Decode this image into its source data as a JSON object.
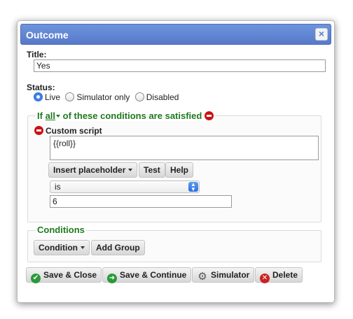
{
  "dialog": {
    "title": "Outcome",
    "close_icon": "close-icon"
  },
  "title_field": {
    "label": "Title:",
    "value": "Yes"
  },
  "status": {
    "label": "Status:",
    "options": [
      {
        "label": "Live",
        "checked": true
      },
      {
        "label": "Simulator only",
        "checked": false
      },
      {
        "label": "Disabled",
        "checked": false
      }
    ]
  },
  "condition_group": {
    "prefix": "If",
    "mode": "all",
    "suffix": "of these conditions are satisfied",
    "condition": {
      "label": "Custom script",
      "script": "{{roll}}",
      "insert_placeholder_label": "Insert placeholder",
      "test_label": "Test",
      "help_label": "Help",
      "operator": "is",
      "value": "6"
    }
  },
  "conditions_section": {
    "title": "Conditions",
    "condition_button": "Condition",
    "add_group_button": "Add Group"
  },
  "footer": {
    "save_close": "Save & Close",
    "save_continue": "Save & Continue",
    "simulator": "Simulator",
    "delete": "Delete"
  },
  "colors": {
    "titlebar": "#5b7fcd",
    "green_text": "#1d7a1d",
    "remove_red": "#cc1111"
  }
}
